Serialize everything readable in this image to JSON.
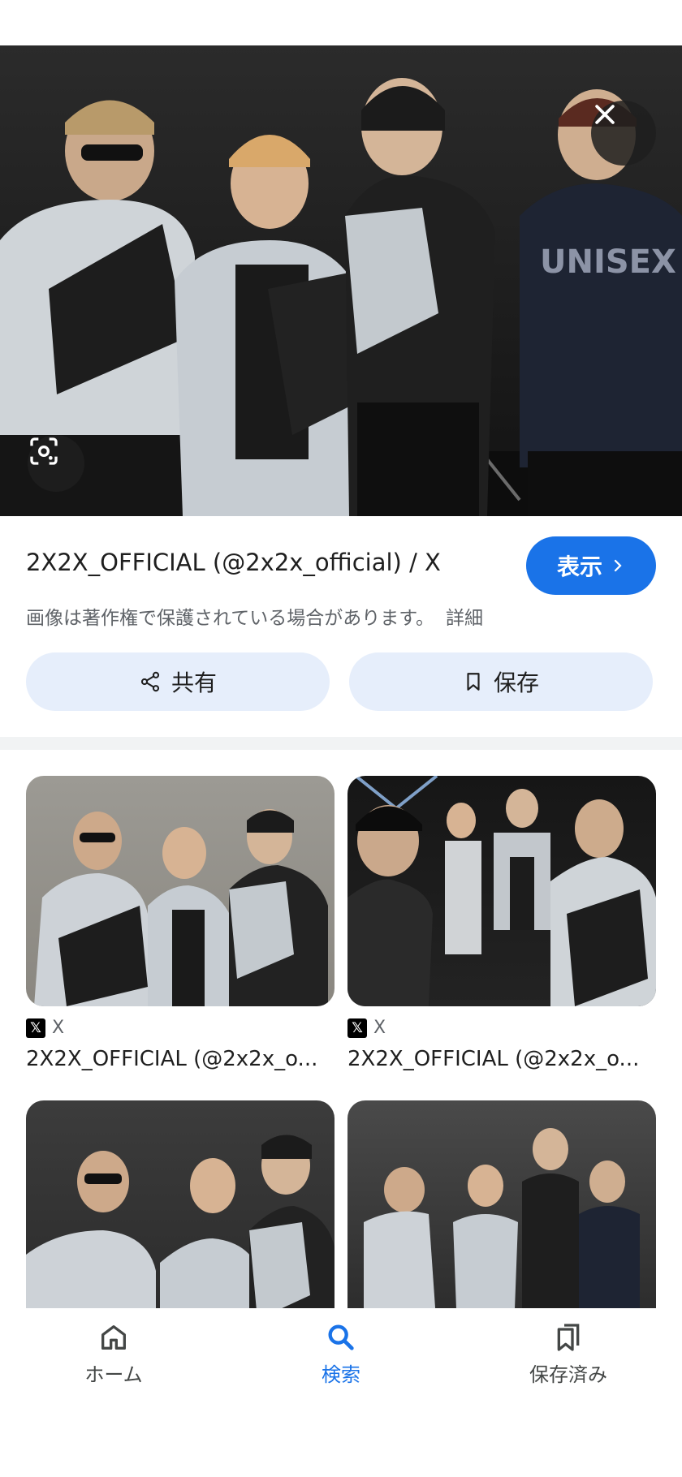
{
  "result": {
    "title": "2X2X_OFFICIAL (@2x2x_official) / X",
    "view_label": "表示",
    "copyright_notice": "画像は著作権で保護されている場合があります。",
    "detail_link": "詳細",
    "share_label": "共有",
    "save_label": "保存"
  },
  "related": [
    {
      "source": "X",
      "caption": "2X2X_OFFICIAL (@2x2x_o..."
    },
    {
      "source": "X",
      "caption": "2X2X_OFFICIAL (@2x2x_o..."
    }
  ],
  "nav": {
    "home": "ホーム",
    "search": "検索",
    "saved": "保存済み"
  },
  "icons": {
    "close": "close-icon",
    "lens": "lens-icon",
    "view_arrow": "chevron-right-icon",
    "share": "share-icon",
    "save": "bookmark-icon",
    "home": "home-icon",
    "search": "search-icon",
    "saved": "bookmarks-icon",
    "source_logo": "x-logo-icon"
  },
  "colors": {
    "accent": "#1a73e8",
    "pill_bg": "#e6eefb",
    "secondary_text": "#5f6368"
  }
}
